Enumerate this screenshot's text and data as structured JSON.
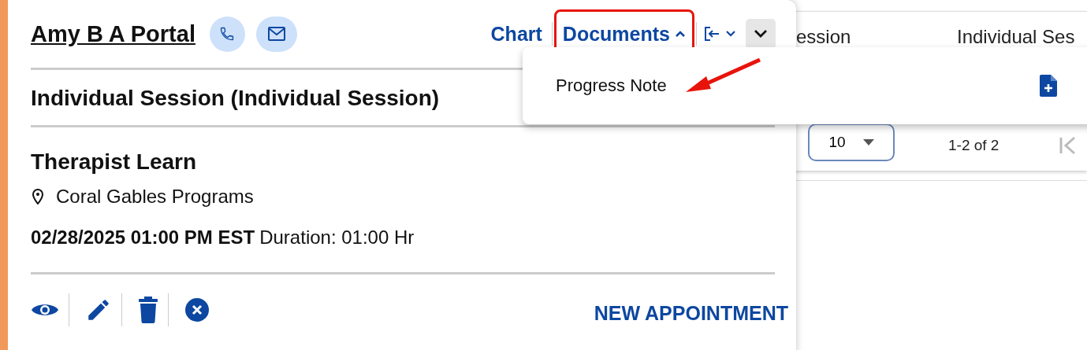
{
  "background_table": {
    "columns": [
      "ession",
      "Individual Ses"
    ],
    "rows_per_page": "10",
    "range": "1-2 of 2"
  },
  "popup": {
    "client_name": "Amy B A Portal",
    "nav": [
      {
        "label": "Chart",
        "kind": "link",
        "highlighted": false
      },
      {
        "label": "Documents",
        "kind": "dropdown",
        "expanded": true,
        "highlighted": true
      }
    ],
    "title": "Individual Session (Individual Session)",
    "provider": "Therapist Learn",
    "location": "Coral Gables Programs",
    "datetime": "02/28/2025 01:00 PM EST",
    "duration": "Duration: 01:00 Hr",
    "new_appointment": "NEW APPOINTMENT"
  },
  "documents_menu": {
    "items": [
      {
        "label": "Progress Note"
      }
    ]
  }
}
